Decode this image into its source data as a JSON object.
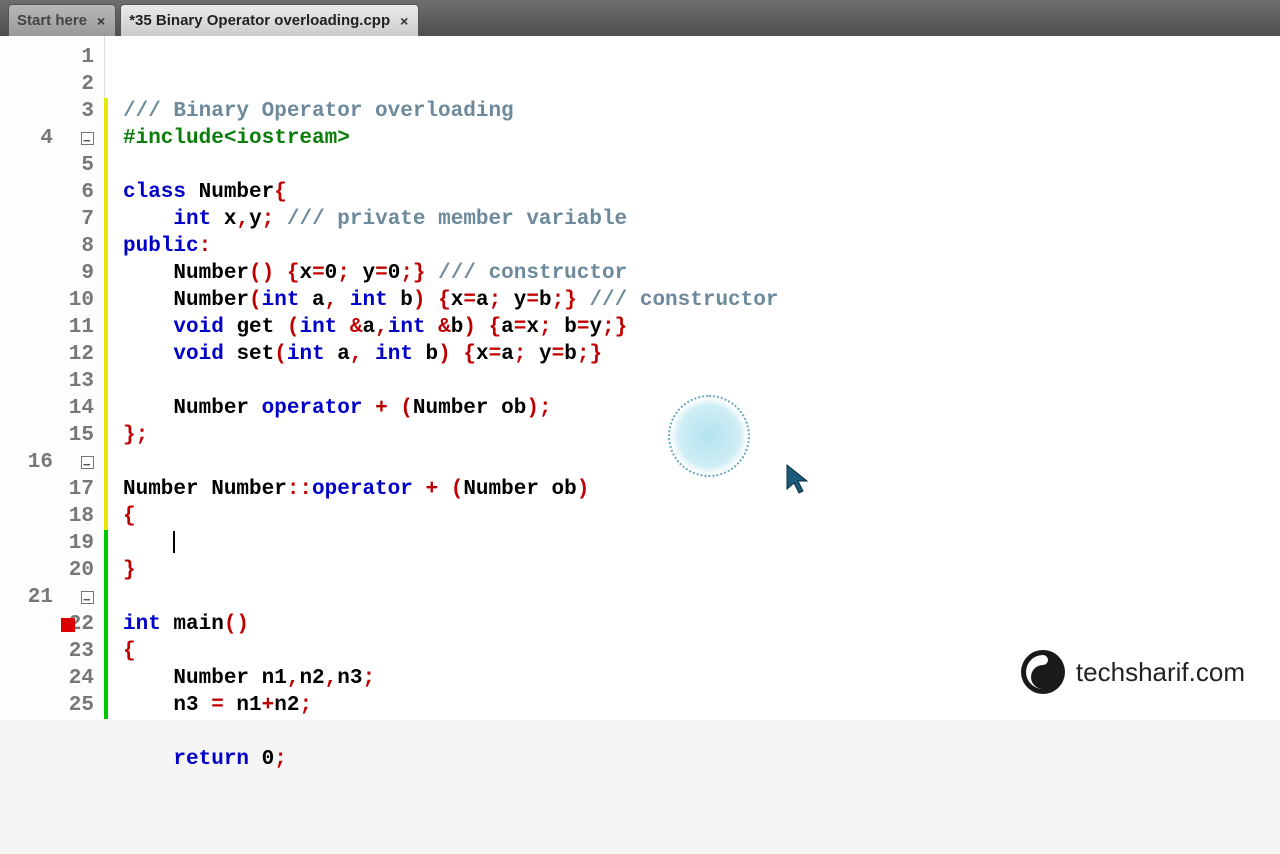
{
  "tabs": [
    {
      "label": "Start here",
      "active": false
    },
    {
      "label": "*35 Binary Operator overloading.cpp",
      "active": true
    }
  ],
  "watermark_text": "techsharif.com",
  "gutter": {
    "first": 1,
    "last": 25,
    "folds": [
      4,
      16,
      21
    ],
    "breakpoints": [
      22
    ],
    "yellow_range": [
      3,
      18
    ],
    "green_range": [
      19,
      25
    ]
  },
  "code": [
    {
      "n": 1,
      "tokens": [
        {
          "t": "/// Binary Operator overloading",
          "c": "c-comment"
        }
      ]
    },
    {
      "n": 2,
      "tokens": [
        {
          "t": "#include<iostream>",
          "c": "c-green"
        }
      ]
    },
    {
      "n": 3,
      "tokens": []
    },
    {
      "n": 4,
      "tokens": [
        {
          "t": "class",
          "c": "c-blue"
        },
        {
          "t": " Number",
          "c": "c-black"
        },
        {
          "t": "{",
          "c": "c-red"
        }
      ]
    },
    {
      "n": 5,
      "tokens": [
        {
          "t": "    ",
          "c": ""
        },
        {
          "t": "int",
          "c": "c-blue"
        },
        {
          "t": " x",
          "c": "c-black"
        },
        {
          "t": ",",
          "c": "c-red"
        },
        {
          "t": "y",
          "c": "c-black"
        },
        {
          "t": ";",
          "c": "c-red"
        },
        {
          "t": " ",
          "c": ""
        },
        {
          "t": "/// private member variable",
          "c": "c-comment"
        }
      ]
    },
    {
      "n": 6,
      "tokens": [
        {
          "t": "public",
          "c": "c-blue"
        },
        {
          "t": ":",
          "c": "c-red"
        }
      ]
    },
    {
      "n": 7,
      "tokens": [
        {
          "t": "    Number",
          "c": "c-black"
        },
        {
          "t": "() {",
          "c": "c-red"
        },
        {
          "t": "x",
          "c": "c-black"
        },
        {
          "t": "=",
          "c": "c-red"
        },
        {
          "t": "0",
          "c": "c-black"
        },
        {
          "t": ";",
          "c": "c-red"
        },
        {
          "t": " y",
          "c": "c-black"
        },
        {
          "t": "=",
          "c": "c-red"
        },
        {
          "t": "0",
          "c": "c-black"
        },
        {
          "t": ";}",
          "c": "c-red"
        },
        {
          "t": " ",
          "c": ""
        },
        {
          "t": "/// constructor",
          "c": "c-comment"
        }
      ]
    },
    {
      "n": 8,
      "tokens": [
        {
          "t": "    Number",
          "c": "c-black"
        },
        {
          "t": "(",
          "c": "c-red"
        },
        {
          "t": "int",
          "c": "c-blue"
        },
        {
          "t": " a",
          "c": "c-black"
        },
        {
          "t": ",",
          "c": "c-red"
        },
        {
          "t": " ",
          "c": ""
        },
        {
          "t": "int",
          "c": "c-blue"
        },
        {
          "t": " b",
          "c": "c-black"
        },
        {
          "t": ") {",
          "c": "c-red"
        },
        {
          "t": "x",
          "c": "c-black"
        },
        {
          "t": "=",
          "c": "c-red"
        },
        {
          "t": "a",
          "c": "c-black"
        },
        {
          "t": ";",
          "c": "c-red"
        },
        {
          "t": " y",
          "c": "c-black"
        },
        {
          "t": "=",
          "c": "c-red"
        },
        {
          "t": "b",
          "c": "c-black"
        },
        {
          "t": ";}",
          "c": "c-red"
        },
        {
          "t": " ",
          "c": ""
        },
        {
          "t": "/// constructor",
          "c": "c-comment"
        }
      ]
    },
    {
      "n": 9,
      "tokens": [
        {
          "t": "    ",
          "c": ""
        },
        {
          "t": "void",
          "c": "c-blue"
        },
        {
          "t": " get ",
          "c": "c-black"
        },
        {
          "t": "(",
          "c": "c-red"
        },
        {
          "t": "int",
          "c": "c-blue"
        },
        {
          "t": " ",
          "c": ""
        },
        {
          "t": "&",
          "c": "c-red"
        },
        {
          "t": "a",
          "c": "c-black"
        },
        {
          "t": ",",
          "c": "c-red"
        },
        {
          "t": "int",
          "c": "c-blue"
        },
        {
          "t": " ",
          "c": ""
        },
        {
          "t": "&",
          "c": "c-red"
        },
        {
          "t": "b",
          "c": "c-black"
        },
        {
          "t": ") {",
          "c": "c-red"
        },
        {
          "t": "a",
          "c": "c-black"
        },
        {
          "t": "=",
          "c": "c-red"
        },
        {
          "t": "x",
          "c": "c-black"
        },
        {
          "t": ";",
          "c": "c-red"
        },
        {
          "t": " b",
          "c": "c-black"
        },
        {
          "t": "=",
          "c": "c-red"
        },
        {
          "t": "y",
          "c": "c-black"
        },
        {
          "t": ";}",
          "c": "c-red"
        }
      ]
    },
    {
      "n": 10,
      "tokens": [
        {
          "t": "    ",
          "c": ""
        },
        {
          "t": "void",
          "c": "c-blue"
        },
        {
          "t": " set",
          "c": "c-black"
        },
        {
          "t": "(",
          "c": "c-red"
        },
        {
          "t": "int",
          "c": "c-blue"
        },
        {
          "t": " a",
          "c": "c-black"
        },
        {
          "t": ",",
          "c": "c-red"
        },
        {
          "t": " ",
          "c": ""
        },
        {
          "t": "int",
          "c": "c-blue"
        },
        {
          "t": " b",
          "c": "c-black"
        },
        {
          "t": ") {",
          "c": "c-red"
        },
        {
          "t": "x",
          "c": "c-black"
        },
        {
          "t": "=",
          "c": "c-red"
        },
        {
          "t": "a",
          "c": "c-black"
        },
        {
          "t": ";",
          "c": "c-red"
        },
        {
          "t": " y",
          "c": "c-black"
        },
        {
          "t": "=",
          "c": "c-red"
        },
        {
          "t": "b",
          "c": "c-black"
        },
        {
          "t": ";}",
          "c": "c-red"
        }
      ]
    },
    {
      "n": 11,
      "tokens": []
    },
    {
      "n": 12,
      "tokens": [
        {
          "t": "    Number ",
          "c": "c-black"
        },
        {
          "t": "operator",
          "c": "c-blue"
        },
        {
          "t": " ",
          "c": ""
        },
        {
          "t": "+",
          "c": "c-red"
        },
        {
          "t": " ",
          "c": ""
        },
        {
          "t": "(",
          "c": "c-red"
        },
        {
          "t": "Number ob",
          "c": "c-black"
        },
        {
          "t": ");",
          "c": "c-red"
        }
      ]
    },
    {
      "n": 13,
      "tokens": [
        {
          "t": "};",
          "c": "c-red"
        }
      ]
    },
    {
      "n": 14,
      "tokens": []
    },
    {
      "n": 15,
      "tokens": [
        {
          "t": "Number Number",
          "c": "c-black"
        },
        {
          "t": "::",
          "c": "c-red"
        },
        {
          "t": "operator",
          "c": "c-blue"
        },
        {
          "t": " ",
          "c": ""
        },
        {
          "t": "+",
          "c": "c-red"
        },
        {
          "t": " ",
          "c": ""
        },
        {
          "t": "(",
          "c": "c-red"
        },
        {
          "t": "Number ob",
          "c": "c-black"
        },
        {
          "t": ")",
          "c": "c-red"
        }
      ]
    },
    {
      "n": 16,
      "tokens": [
        {
          "t": "{",
          "c": "c-red"
        }
      ]
    },
    {
      "n": 17,
      "tokens": [],
      "cursor": true
    },
    {
      "n": 18,
      "tokens": [
        {
          "t": "}",
          "c": "c-red"
        }
      ]
    },
    {
      "n": 19,
      "tokens": []
    },
    {
      "n": 20,
      "tokens": [
        {
          "t": "int",
          "c": "c-blue"
        },
        {
          "t": " main",
          "c": "c-black"
        },
        {
          "t": "()",
          "c": "c-red"
        }
      ]
    },
    {
      "n": 21,
      "tokens": [
        {
          "t": "{",
          "c": "c-red"
        }
      ]
    },
    {
      "n": 22,
      "tokens": [
        {
          "t": "    Number n1",
          "c": "c-black"
        },
        {
          "t": ",",
          "c": "c-red"
        },
        {
          "t": "n2",
          "c": "c-black"
        },
        {
          "t": ",",
          "c": "c-red"
        },
        {
          "t": "n3",
          "c": "c-black"
        },
        {
          "t": ";",
          "c": "c-red"
        }
      ]
    },
    {
      "n": 23,
      "tokens": [
        {
          "t": "    n3 ",
          "c": "c-black"
        },
        {
          "t": "=",
          "c": "c-red"
        },
        {
          "t": " n1",
          "c": "c-black"
        },
        {
          "t": "+",
          "c": "c-red"
        },
        {
          "t": "n2",
          "c": "c-black"
        },
        {
          "t": ";",
          "c": "c-red"
        }
      ]
    },
    {
      "n": 24,
      "tokens": []
    },
    {
      "n": 25,
      "tokens": [
        {
          "t": "    ",
          "c": ""
        },
        {
          "t": "return",
          "c": "c-blue"
        },
        {
          "t": " ",
          "c": ""
        },
        {
          "t": "0",
          "c": "c-black"
        },
        {
          "t": ";",
          "c": "c-red"
        }
      ]
    }
  ]
}
